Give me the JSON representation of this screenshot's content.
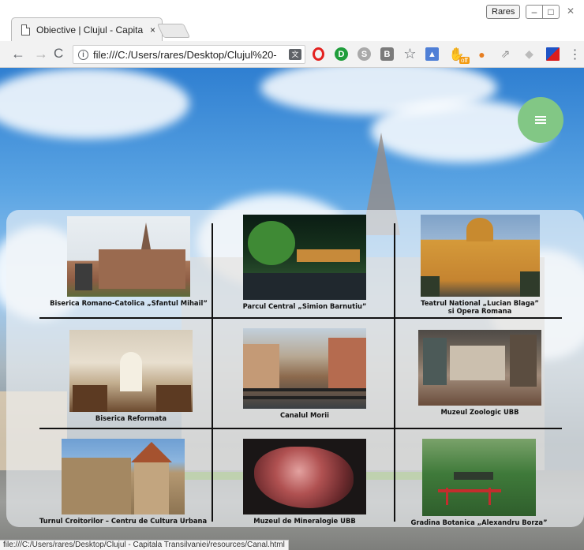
{
  "browser": {
    "tab_title": "Obiective | Clujul - Capita",
    "tab_close": "×",
    "profile_label": "Rares",
    "url": "file:///C:/Users/rares/Desktop/Clujul%20-",
    "status_url": "file:///C:/Users/rares/Desktop/Clujul - Capitala Transilvaniei/resources/Canal.html",
    "nav": {
      "back": "←",
      "forward": "→",
      "reload": "C"
    },
    "window_buttons": {
      "minimize": "–",
      "maximize": "□",
      "close": "✕"
    },
    "extensions": [
      "opera-icon",
      "d-icon",
      "s-icon",
      "bookmark-icon",
      "star-icon",
      "image-icon",
      "off-icon",
      "dog-icon",
      "runner-icon",
      "gray-icon",
      "flag-icon",
      "menu-icon"
    ],
    "ext_off_badge": "off"
  },
  "page": {
    "menu_button": "menu",
    "attractions": [
      {
        "id": "mihail",
        "caption": "Biserica Romano-Catolica „Sfantul Mihail”"
      },
      {
        "id": "parc",
        "caption": "Parcul Central „Simion Barnutiu”"
      },
      {
        "id": "teatru",
        "caption_line1": "Teatrul National „Lucian Blaga”",
        "caption_line2": "si Opera Romana"
      },
      {
        "id": "reformata",
        "caption": "Biserica Reformata"
      },
      {
        "id": "canal",
        "caption": "Canalul Morii"
      },
      {
        "id": "zoologic",
        "caption": "Muzeul Zoologic UBB"
      },
      {
        "id": "croitori",
        "caption": "Turnul Croitorilor – Centru de Cultura Urbana"
      },
      {
        "id": "mineralogie",
        "caption": "Muzeul de Mineralogie UBB"
      },
      {
        "id": "botanica",
        "caption": "Gradina Botanica „Alexandru Borza”"
      }
    ]
  }
}
